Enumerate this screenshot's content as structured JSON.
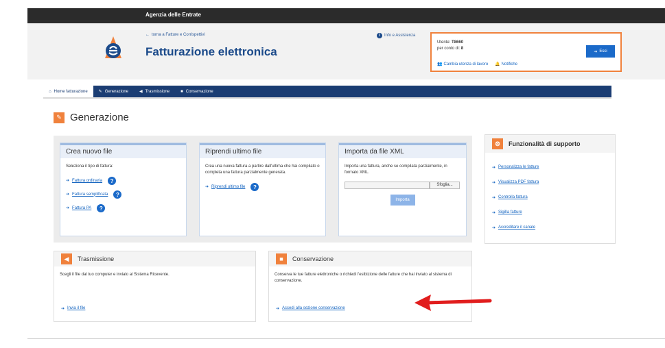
{
  "topbar": {
    "title": "Agenzia delle Entrate"
  },
  "header": {
    "back_link": "torna a Fatture e Corrispettivi",
    "app_title": "Fatturazione elettronica",
    "info_link": "Info e Assistenza"
  },
  "user_box": {
    "user_label": "Utente:",
    "user_value": "T8660",
    "per_conto_label": "per conto di:",
    "per_conto_value": "8",
    "change_link": "Cambia utenza di lavoro",
    "notifiche_link": "Notifiche",
    "esci_label": "Esci"
  },
  "nav": {
    "items": [
      {
        "label": "Home fatturazione",
        "icon": "home-icon"
      },
      {
        "label": "Generazione",
        "icon": "pencil-icon"
      },
      {
        "label": "Trasmissione",
        "icon": "send-icon"
      },
      {
        "label": "Conservazione",
        "icon": "archive-icon"
      }
    ]
  },
  "page": {
    "title": "Generazione"
  },
  "crea": {
    "title": "Crea nuovo file",
    "desc": "Seleziona il tipo di fattura:",
    "links": [
      "Fattura ordinaria",
      "Fattura semplificata",
      "Fattura PA"
    ]
  },
  "riprendi": {
    "title": "Riprendi ultimo file",
    "desc": "Crea una nuova fattura a partire dall'ultima che hai compilato o completa una fattura parzialmente generata.",
    "link": "Riprendi ultimo file"
  },
  "importa": {
    "title": "Importa da file XML",
    "desc": "Importa una fattura, anche se compilata parzialmente, in formato XML.",
    "browse_label": "Sfoglia...",
    "import_button": "Importa"
  },
  "supporto": {
    "title": "Funzionalità di supporto",
    "links": [
      "Personalizza le fatture",
      "Visualizza PDF fattura",
      "Controlla fattura",
      "Sigilla fatture",
      "Accreditare il canale"
    ]
  },
  "trasmissione": {
    "title": "Trasmissione",
    "desc": "Scegli il file dal tuo computer e invialo al Sistema Ricevente.",
    "link": "Invia il file"
  },
  "conservazione": {
    "title": "Conservazione",
    "desc": "Conserva le tue fatture elettroniche o richiedi l'esibizione delle fatture che hai inviato al sistema di conservazione.",
    "link": "Accedi alla sezione conservazione"
  },
  "colors": {
    "nav_bg": "#1b3d73",
    "accent_orange": "#f0813c",
    "link_blue": "#1565c0",
    "annotation_red": "#e11d1d"
  }
}
